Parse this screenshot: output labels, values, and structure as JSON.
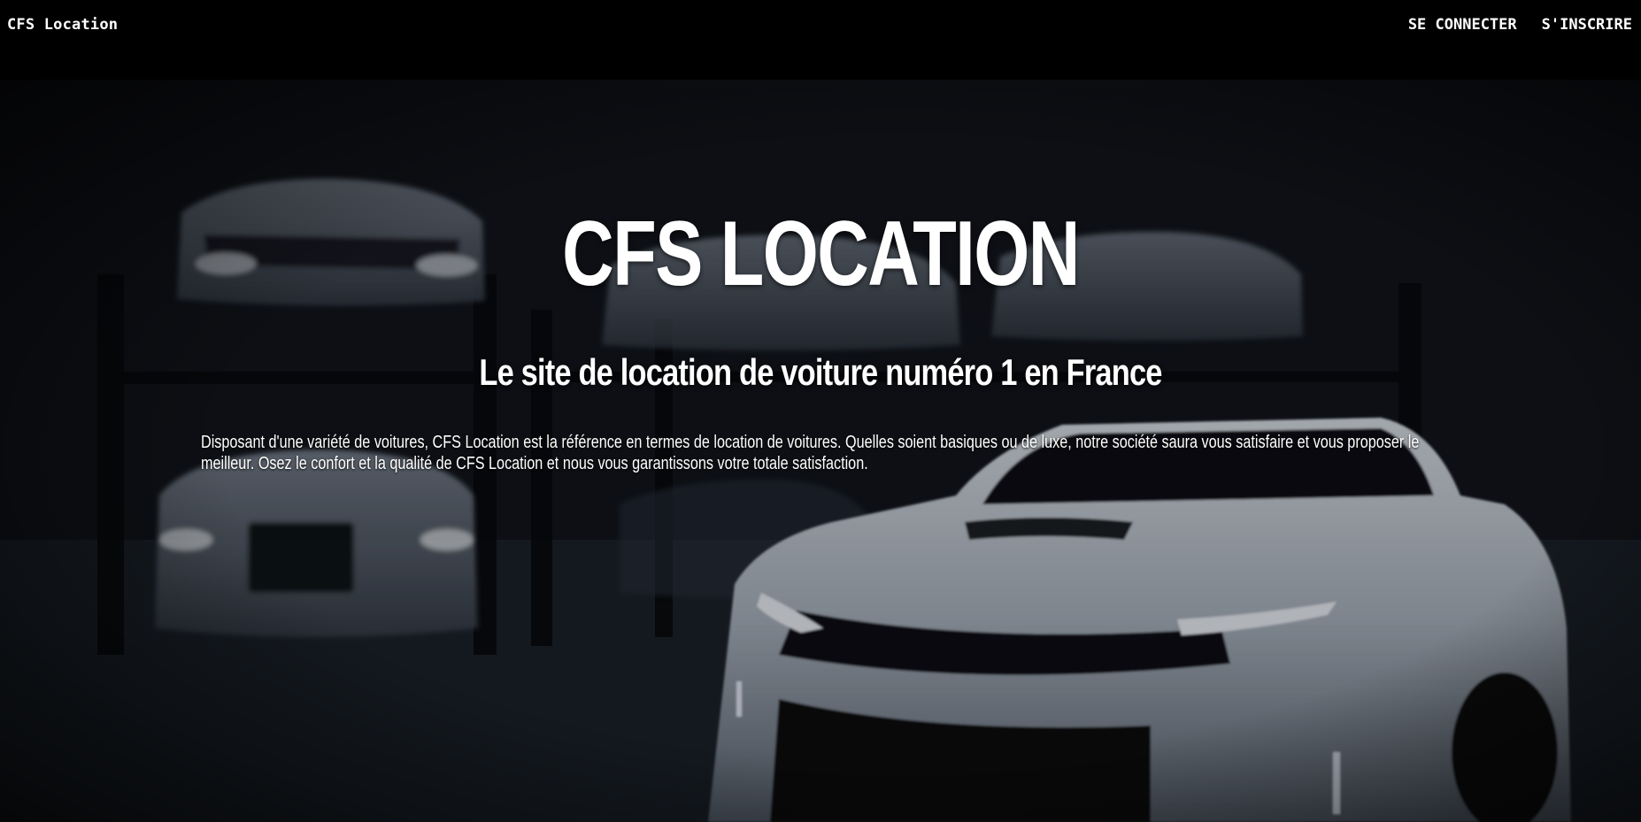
{
  "header": {
    "brand": "CFS Location",
    "nav": {
      "login_label": "SE CONNECTER",
      "signup_label": "S'INSCRIRE"
    }
  },
  "hero": {
    "title": "CFS LOCATION",
    "subtitle": "Le site de location de voiture numéro 1 en France",
    "description": "Disposant d'une variété de voitures, CFS Location est la référence en termes de location de voitures. Quelles soient basiques ou de luxe, notre société saura vous satisfaire et vous proposer le meilleur. Osez le confort et la qualité de CFS Location et nous vous garantissons votre totale satisfaction."
  },
  "colors": {
    "header_bg": "#000000",
    "text": "#ffffff",
    "car_white": "#c9d2dd"
  }
}
